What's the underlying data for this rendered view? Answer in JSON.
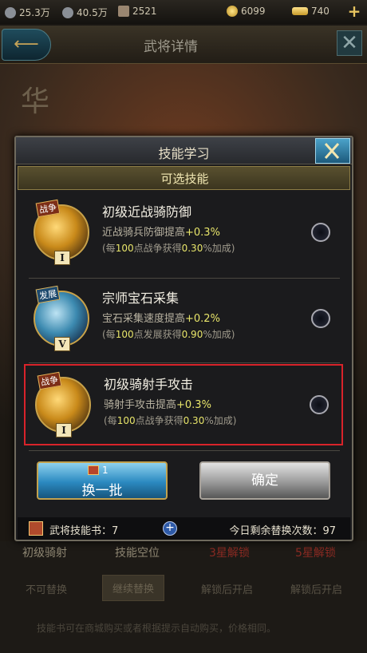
{
  "resources": [
    {
      "icon": "stone-icon",
      "value": "25.3万"
    },
    {
      "icon": "iron-icon",
      "value": "40.5万"
    },
    {
      "icon": "wood-icon",
      "value": "2521"
    },
    {
      "icon": "gold-icon",
      "value": "6099"
    },
    {
      "icon": "ingot-icon",
      "value": "740"
    }
  ],
  "header": {
    "title": "武将详情",
    "hero_name": "华"
  },
  "modal": {
    "title": "技能学习",
    "subtitle": "可选技能",
    "skills": [
      {
        "tag": "战争",
        "rank": "I",
        "name": "初级近战骑防御",
        "desc": "近战骑兵防御提高",
        "bonus": "+0.3%",
        "note_pre": "(每",
        "note_num1": "100",
        "note_mid": "点战争获得",
        "note_num2": "0.30",
        "note_post": "%加成)",
        "selected": false
      },
      {
        "tag": "发展",
        "rank": "V",
        "name": "宗师宝石采集",
        "desc": "宝石采集速度提高",
        "bonus": "+0.2%",
        "note_pre": "(每",
        "note_num1": "100",
        "note_mid": "点发展获得",
        "note_num2": "0.90",
        "note_post": "%加成)",
        "selected": false
      },
      {
        "tag": "战争",
        "rank": "I",
        "name": "初级骑射手攻击",
        "desc": "骑射手攻击提高",
        "bonus": "+0.3%",
        "note_pre": "(每",
        "note_num1": "100",
        "note_mid": "点战争获得",
        "note_num2": "0.30",
        "note_post": "%加成)",
        "selected": true
      }
    ],
    "refresh_button": {
      "cost": "1",
      "label": "换一批"
    },
    "confirm_button": {
      "label": "确定"
    },
    "footer": {
      "books_label": "武将技能书：",
      "books_count": "7",
      "remaining_label": "今日剩余替换次数：",
      "remaining_count": "97"
    }
  },
  "background": {
    "row1": [
      "初级骑射",
      "技能空位",
      "3星解锁",
      "5星解锁"
    ],
    "row2": [
      "不可替换",
      "继续替换",
      "解锁后开启",
      "解锁后开启"
    ],
    "note": "技能书可在商城购买或者根据提示自动购买，价格相同。"
  }
}
